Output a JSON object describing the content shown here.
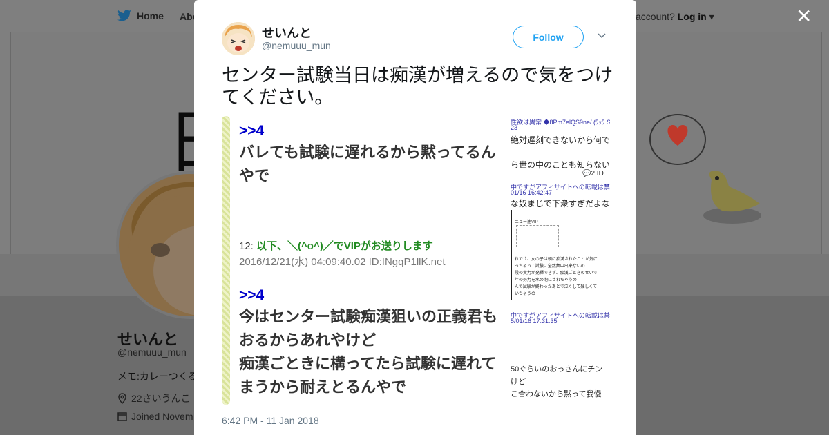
{
  "background": {
    "nav": {
      "home": "Home",
      "about": "Abo",
      "account_prompt": "account?",
      "login": "Log in"
    },
    "banner_text": "日\n常",
    "profile": {
      "name": "せいんと",
      "handle": "@nemuuu_mun",
      "bio": "メモ:カレーつくる",
      "location": "22さいうんこ",
      "joined": "Joined Novem"
    }
  },
  "modal": {
    "close_label": "✕",
    "author": {
      "name": "せいんと",
      "handle": "@nemuuu_mun"
    },
    "follow_label": "Follow",
    "tweet_text": "センター試験当日は痴漢が増えるので気をつけてください。",
    "timestamp": "6:42 PM - 11 Jan 2018",
    "media": {
      "post1": {
        "ref": ">>4",
        "body": "バレても試験に遅れるから黙ってるんやで",
        "num": "12:",
        "poster": "以下、＼(^o^)／でVIPがお送りします",
        "date": "2016/12/21(水) 04:09:40.02 ID:INgqP1llK.net"
      },
      "post2": {
        "ref": ">>4",
        "body_line1": "今はセンター試験痴漢狙いの正義君もおるからあれやけど",
        "body_line2": "痴漢ごときに構ってたら試験に遅れてまうから耐えとるんやで"
      },
      "thumb": {
        "line1": "性欲は異常 ◆8Pm7elQS9ne/ (ﾜｯﾜ S",
        "line2": "23",
        "line3": "絶対遅刻できないから何で",
        "line4": "ら世の中のことも知らない",
        "line5": "💬2  ID",
        "line6": "中ですがアフィサイトへの転載は禁止",
        "line7": "01/16 16:42:47",
        "line8": "な奴まじで下衆すぎだよな",
        "line9": "ニュー速VIP",
        "line10": "れでさ、女の子は朝に痴漢されたことが気に",
        "line11": "っちゃって試験に全然集中出来ないの",
        "line12": "段の実力が発揮できず、痴漢ごときのせいで",
        "line13": "年の努力を水の泡にされちゃうの",
        "line14": "んで試験が終わったあとで泣くして残しくて",
        "line15": "いちゃうの",
        "line16": "中ですがアフィサイトへの転載は禁止",
        "line17": "5/01/16 17:31:35",
        "line18": "50ぐらいのおっさんにチン",
        "line19": "けど",
        "line20": "こ合わないから黙って我慢"
      }
    }
  },
  "colors": {
    "accent": "#1da1f2",
    "ref_blue": "#0000cc",
    "poster_green": "#228b22"
  }
}
